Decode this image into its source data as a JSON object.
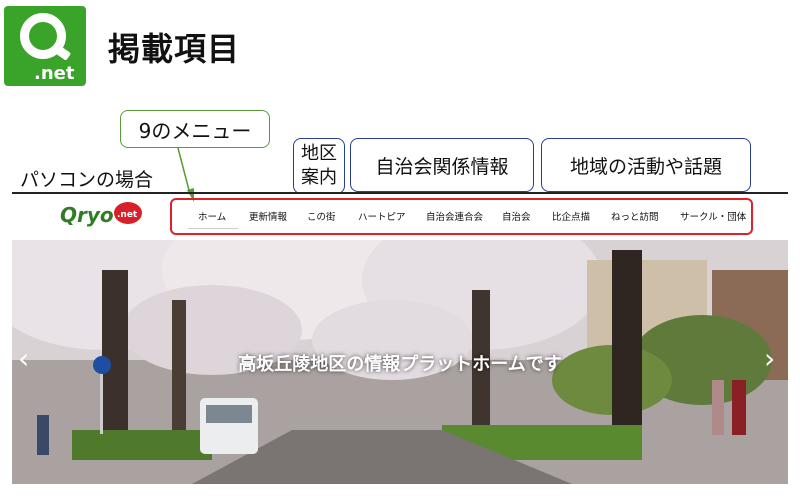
{
  "header": {
    "logo_text": ".net",
    "title": "掲載項目"
  },
  "callouts": {
    "menu": "9のメニュー",
    "area_line1": "地区",
    "area_line2": "案内",
    "jichikai": "自治会関係情報",
    "activity": "地域の活動や話題"
  },
  "pc_label": "パソコンの場合",
  "site": {
    "logo_text": "Qryo.net",
    "nav": [
      {
        "label": "ホーム"
      },
      {
        "label": "更新情報"
      },
      {
        "label": "この街"
      },
      {
        "label": "ハートピア"
      },
      {
        "label": "自治会連合会"
      },
      {
        "label": "自治会"
      },
      {
        "label": "比企点描"
      },
      {
        "label": "ねっと訪問"
      },
      {
        "label": "サークル・団体"
      }
    ],
    "hero_caption": "高坂丘陵地区の情報プラットホームです",
    "prev_arrow": "‹",
    "next_arrow": "›"
  },
  "colors": {
    "logo_green": "#3aa329",
    "highlight_red": "#e0202a",
    "callout_border": "#2a3e8c"
  }
}
